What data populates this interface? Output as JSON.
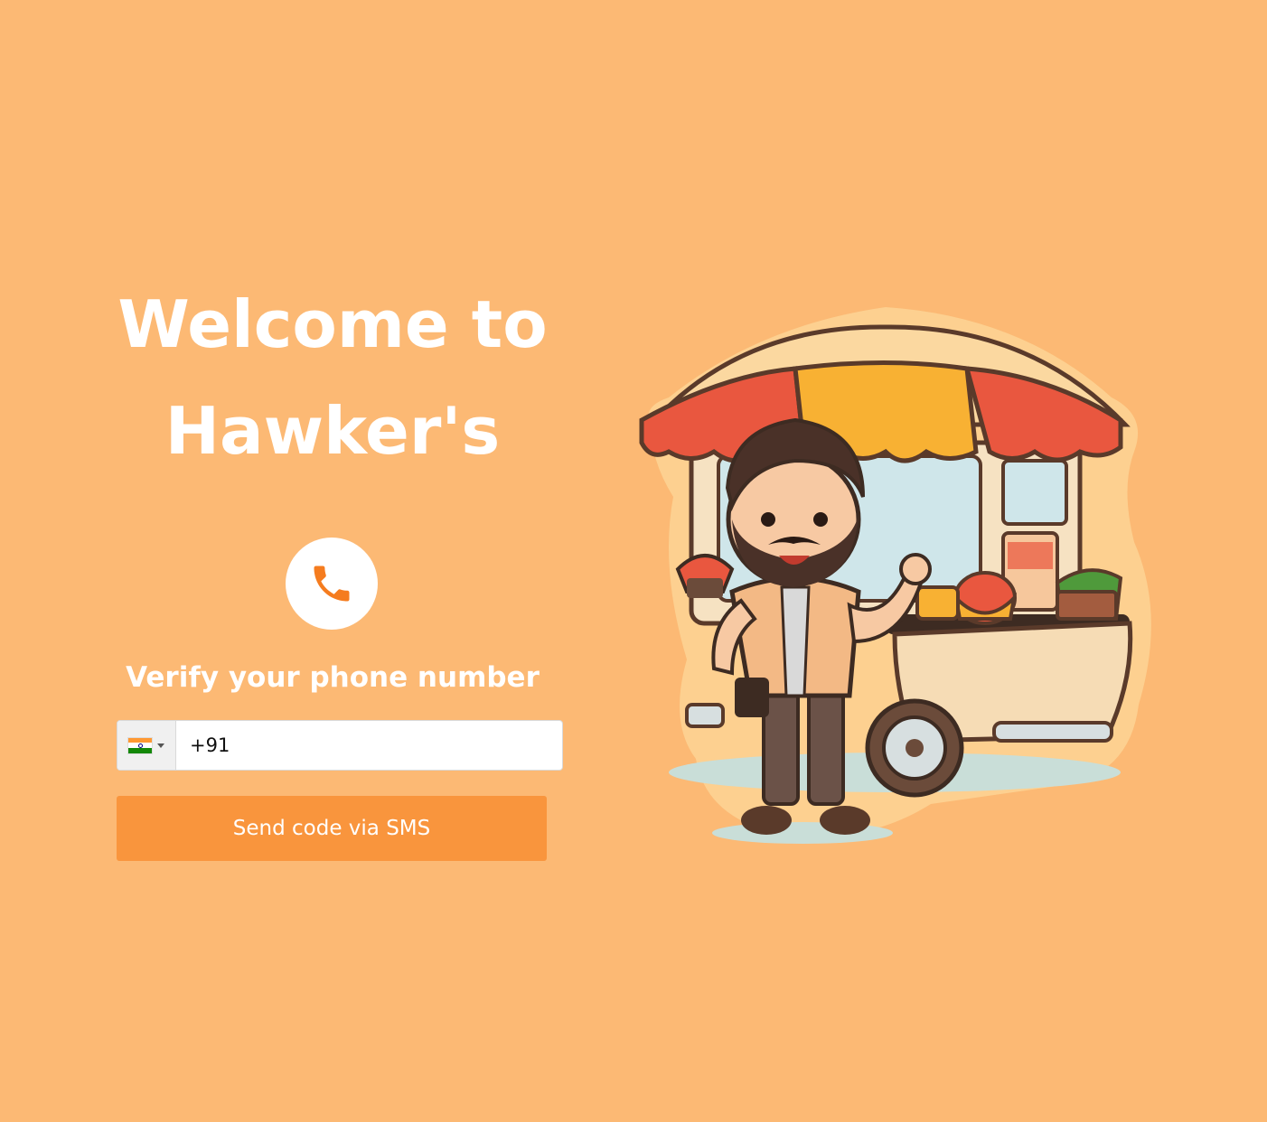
{
  "header": {
    "title_line1": "Welcome to",
    "title_line2": "Hawker's"
  },
  "verify": {
    "icon": "phone-icon",
    "subtitle": "Verify your phone number"
  },
  "phone_input": {
    "country_flag": "india-flag-icon",
    "value": "+91"
  },
  "actions": {
    "send_label": "Send code via SMS"
  },
  "colors": {
    "background": "#fcb974",
    "accent": "#f9953d",
    "phone_icon": "#f57c1f"
  },
  "illustration": {
    "name": "hawker-cart-illustration"
  }
}
